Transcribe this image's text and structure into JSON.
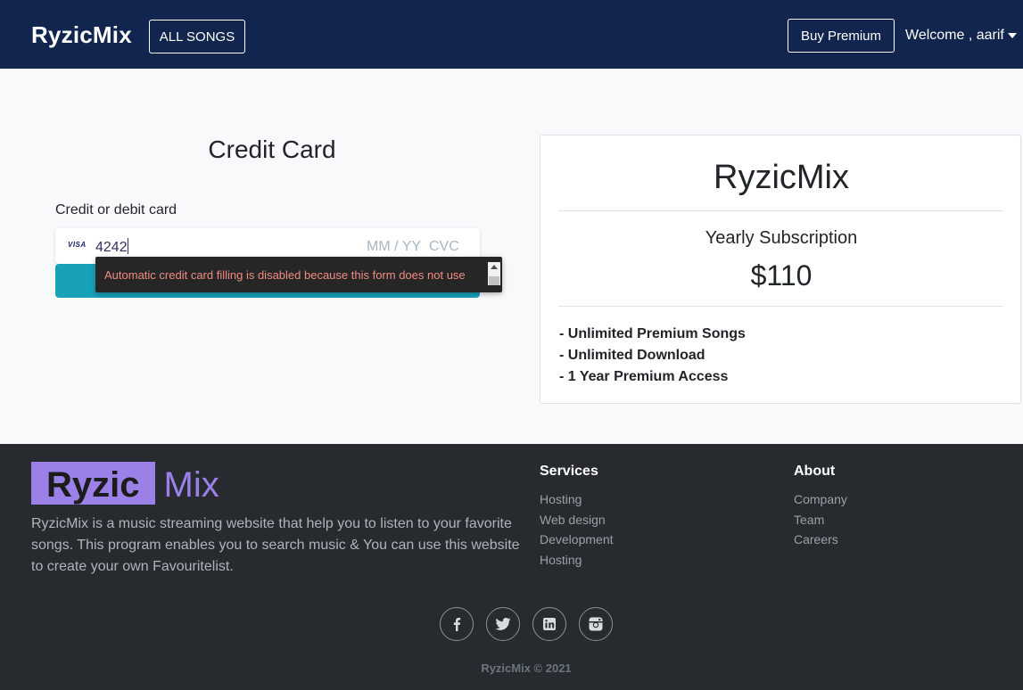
{
  "navbar": {
    "brand": "RyzicMix",
    "all_songs": "ALL SONGS",
    "buy_premium": "Buy Premium",
    "welcome": "Welcome , aarif"
  },
  "form": {
    "title": "Credit Card",
    "label": "Credit or debit card",
    "card_brand": "VISA",
    "card_number": "4242",
    "expiry_placeholder": "MM / YY",
    "cvc_placeholder": "CVC",
    "autofill_warning": "Automatic credit card filling is disabled because this form does not use"
  },
  "plan": {
    "name": "RyzicMix",
    "subscription": "Yearly Subscription",
    "price": "$110",
    "features": [
      "- Unlimited Premium Songs",
      "- Unlimited Download",
      "- 1 Year Premium Access"
    ]
  },
  "footer": {
    "logo_part1": "Ryzic",
    "logo_part2": "Mix",
    "description": "RyzicMix is a music streaming website that help you to listen to your favorite songs. This program enables you to search music & You can use this website to create your own Favouritelist.",
    "services": {
      "heading": "Services",
      "items": [
        "Hosting",
        "Web design",
        "Development",
        "Hosting"
      ]
    },
    "about": {
      "heading": "About",
      "items": [
        "Company",
        "Team",
        "Careers"
      ]
    },
    "social_icons": [
      "facebook-icon",
      "twitter-icon",
      "linkedin-icon",
      "instagram-icon"
    ],
    "copyright": "RyzicMix © 2021"
  },
  "colors": {
    "navbar": "#11254e",
    "accent_button": "#17a2b8",
    "logo_purple": "#9b80e8",
    "footer_bg": "#272b30"
  }
}
